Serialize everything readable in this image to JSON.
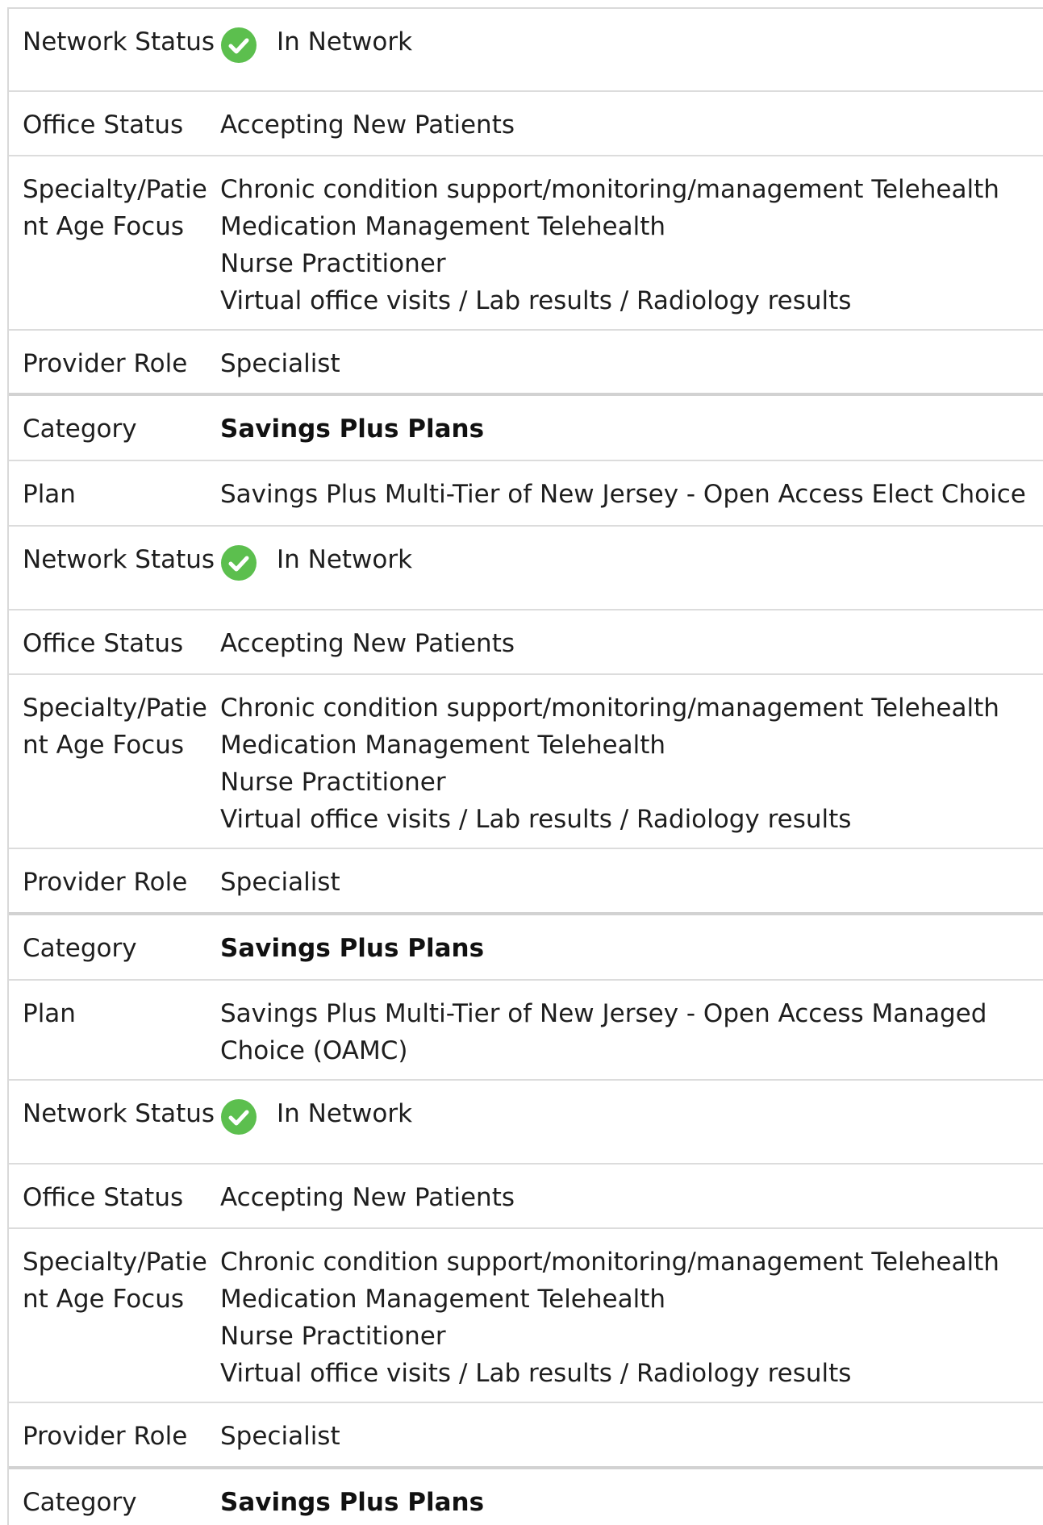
{
  "colors": {
    "check_green": "#5cbf4e",
    "divider": "#dcdcdc",
    "text": "#1e1e1e"
  },
  "labels": {
    "network_status": "Network Status",
    "office_status": "Office Status",
    "specialty_line1": "Specialty/Patie",
    "specialty_line2": "nt Age Focus",
    "provider_role": "Provider Role",
    "category": "Category",
    "plan": "Plan"
  },
  "blocks": [
    {
      "network_status": "In Network",
      "office_status": "Accepting New Patients",
      "specialties": [
        "Chronic condition support/monitoring/management Telehealth",
        "Medication Management Telehealth",
        "Nurse Practitioner",
        "Virtual office visits / Lab results / Radiology results"
      ],
      "provider_role": "Specialist",
      "category": "Savings Plus Plans",
      "plan_lines": [
        "Savings Plus Multi-Tier of New Jersey - Open Access Elect Choice"
      ]
    },
    {
      "network_status": "In Network",
      "office_status": "Accepting New Patients",
      "specialties": [
        "Chronic condition support/monitoring/management Telehealth",
        "Medication Management Telehealth",
        "Nurse Practitioner",
        "Virtual office visits / Lab results / Radiology results"
      ],
      "provider_role": "Specialist",
      "category": "Savings Plus Plans",
      "plan_lines": [
        "Savings Plus Multi-Tier of New Jersey - Open Access Managed",
        "Choice (OAMC)"
      ]
    },
    {
      "network_status": "In Network",
      "office_status": "Accepting New Patients",
      "specialties": [
        "Chronic condition support/monitoring/management Telehealth",
        "Medication Management Telehealth",
        "Nurse Practitioner",
        "Virtual office visits / Lab results / Radiology results"
      ],
      "provider_role": "Specialist",
      "category": "Savings Plus Plans"
    }
  ]
}
